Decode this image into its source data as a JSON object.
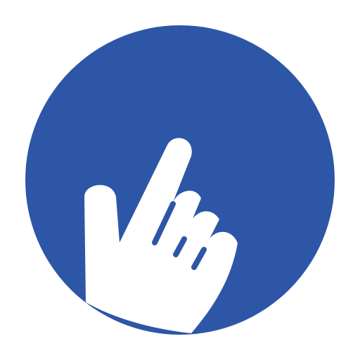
{
  "icon": {
    "name": "pointing-hand-icon",
    "background_color": "#ffffff",
    "circle_color": "#2d56a6",
    "hand_color": "#ffffff"
  }
}
